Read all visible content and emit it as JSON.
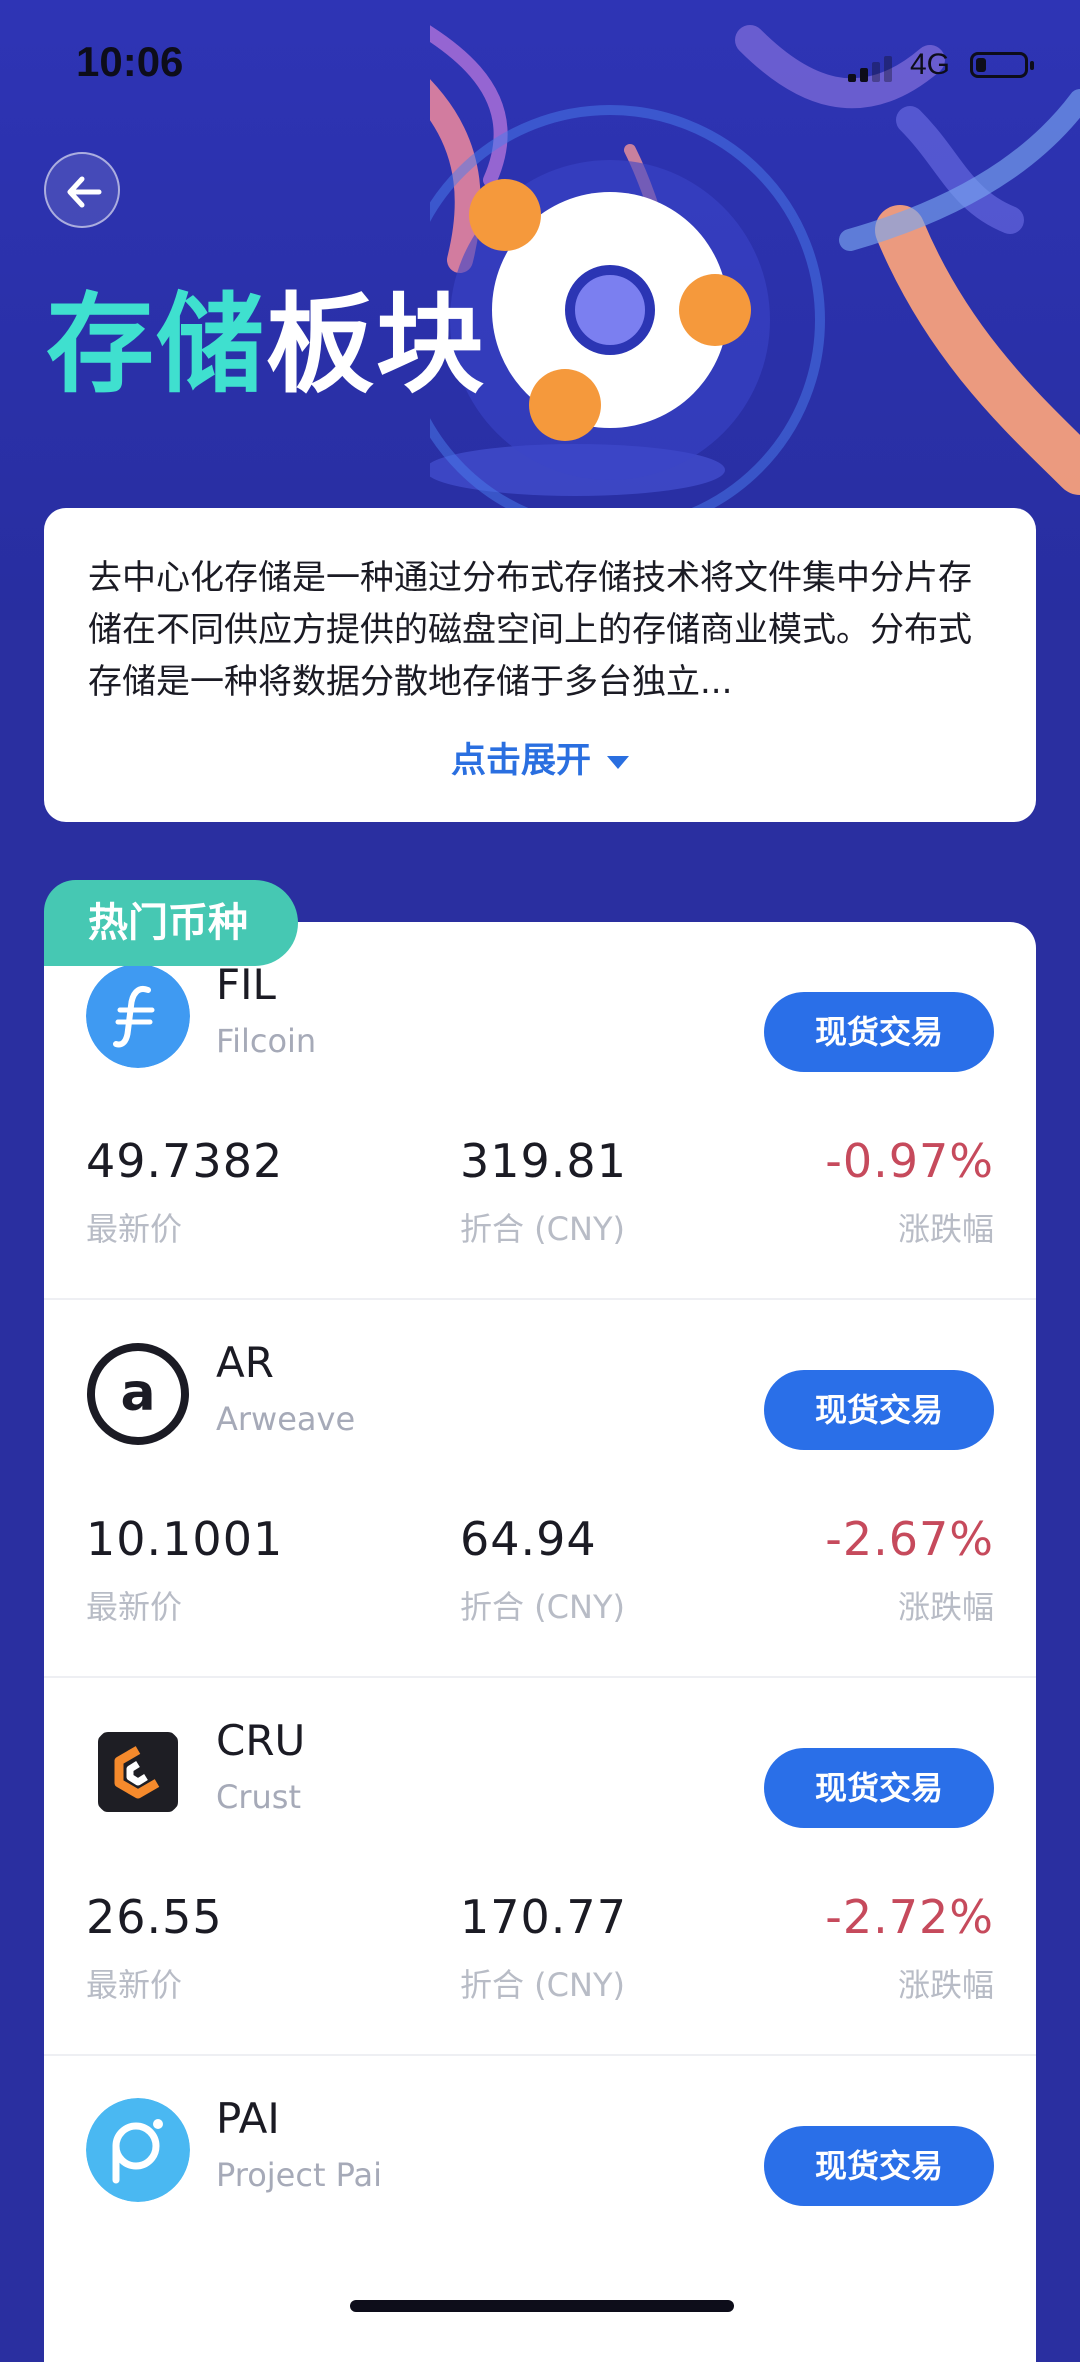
{
  "status_bar": {
    "time": "10:06",
    "network": "4G"
  },
  "hero": {
    "title_accent": "存储",
    "title_rest": "板块"
  },
  "intro": {
    "text": "去中心化存储是一种通过分布式存储技术将文件集中分片存储在不同供应方提供的磁盘空间上的存储商业模式。分布式存储是一种将数据分散地存储于多台独立...",
    "expand_label": "点击展开"
  },
  "section": {
    "title": "热门币种"
  },
  "labels": {
    "trade": "现货交易",
    "latest_price": "最新价",
    "cny": "折合 (CNY)",
    "change": "涨跌幅"
  },
  "coins": [
    {
      "symbol": "FIL",
      "name": "Filcoin",
      "price": "49.7382",
      "cny": "319.81",
      "change": "-0.97%",
      "icon": "filecoin-icon"
    },
    {
      "symbol": "AR",
      "name": "Arweave",
      "price": "10.1001",
      "cny": "64.94",
      "change": "-2.67%",
      "icon": "arweave-icon"
    },
    {
      "symbol": "CRU",
      "name": "Crust",
      "price": "26.55",
      "cny": "170.77",
      "change": "-2.72%",
      "icon": "crust-icon"
    },
    {
      "symbol": "PAI",
      "name": "Project Pai",
      "icon": "project-pai-icon"
    }
  ],
  "colors": {
    "accent": "#2a6fe8",
    "teal": "#46c8b3",
    "negative": "#c64a5c",
    "hero_bg": "#2e34b5"
  }
}
